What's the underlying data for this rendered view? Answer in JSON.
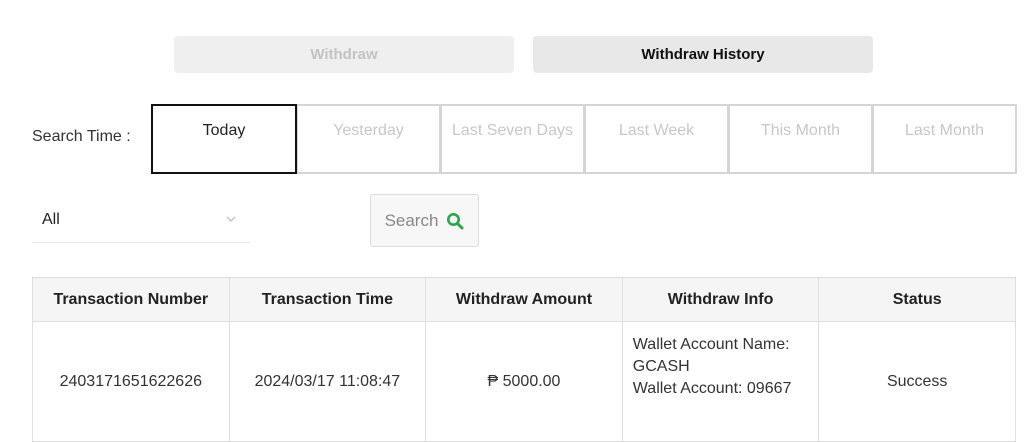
{
  "tabs": {
    "withdraw": "Withdraw",
    "withdraw_history": "Withdraw History"
  },
  "search_time": {
    "label": "Search Time :",
    "periods": [
      "Today",
      "Yesterday",
      "Last Seven Days",
      "Last Week",
      "This Month",
      "Last Month"
    ],
    "selected": "Today"
  },
  "filter": {
    "status_select": "All",
    "search_button": "Search"
  },
  "table": {
    "headers": [
      "Transaction Number",
      "Transaction Time",
      "Withdraw Amount",
      "Withdraw Info",
      "Status"
    ],
    "rows": [
      {
        "number": "2403171651622626",
        "time": "2024/03/17 11:08:47",
        "amount": "₱ 5000.00",
        "info_name": "Wallet Account Name: GCASH",
        "info_account": "Wallet Account: 09667",
        "status": "Success"
      }
    ]
  },
  "colors": {
    "search_icon": "#2ca64a",
    "active_border": "#111111",
    "inactive_text": "#c8c8c8"
  }
}
